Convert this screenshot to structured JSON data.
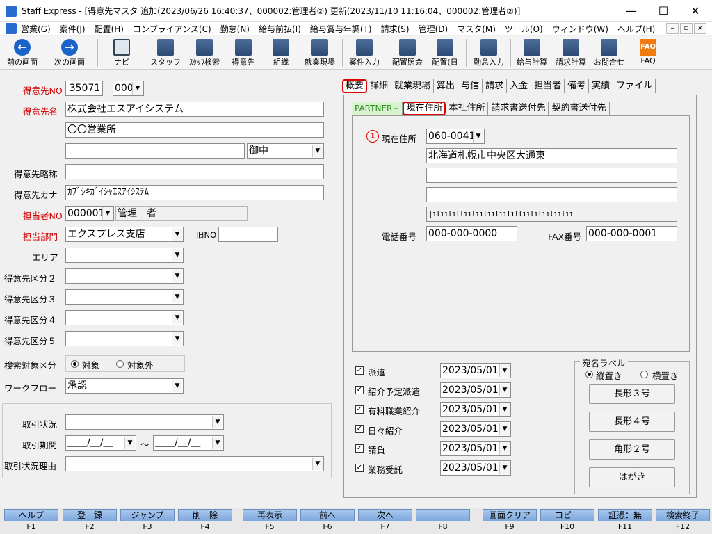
{
  "window": {
    "title": "Staff Express - [得意先マスタ  追加(2023/06/26 16:40:37、000002:管理者②)  更新(2023/11/10 11:16:04、000002:管理者②)]",
    "min": "—",
    "max": "☐",
    "close": "✕"
  },
  "menu": [
    "営業(G)",
    "案件(J)",
    "配置(H)",
    "コンプライアンス(C)",
    "勤怠(N)",
    "給与前払(I)",
    "給与賞与年調(T)",
    "請求(S)",
    "管理(D)",
    "マスタ(M)",
    "ツール(O)",
    "ウィンドウ(W)",
    "ヘルプ(H)"
  ],
  "mdi": [
    "–",
    "▫",
    "×"
  ],
  "toolbar": {
    "back": "前の画面",
    "forward": "次の画面",
    "navi": "ナビ",
    "staff": "スタッフ",
    "staff_search": "ｽﾀｯﾌ検索",
    "customer": "得意先",
    "org": "組織",
    "site": "就業現場",
    "case_entry": "案件入力",
    "placement_query": "配置照会",
    "placement_day": "配置(日",
    "attendance": "勤怠入力",
    "payroll": "給与計算",
    "billing": "請求計算",
    "contact": "お問合せ",
    "faq": "FAQ",
    "faq_icon": "FAQ"
  },
  "form": {
    "code_label": "得意先NO",
    "code": "35071",
    "code_sep": "-",
    "code_sub": "000",
    "name_label": "得意先名",
    "name1": "株式会社エスアイシステム",
    "name2": "〇〇営業所",
    "name3": "",
    "honorific": "御中",
    "short_label": "得意先略称",
    "short": "",
    "kana_label": "得意先カナ",
    "kana": "ｶﾌﾞｼｷｶﾞｲｼｬｴｽｱｲｼｽﾃﾑ",
    "staff_label": "担当者NO",
    "staff_no": "000001",
    "staff_name": "管理　者",
    "dept_label": "担当部門",
    "dept": "エクスプレス支店",
    "old_no_label": "旧NO",
    "old_no": "",
    "area_label": "エリア",
    "cat2_label": "得意先区分２",
    "cat3_label": "得意先区分３",
    "cat4_label": "得意先区分４",
    "cat5_label": "得意先区分５",
    "search_label": "検索対象区分",
    "search_on": "対象",
    "search_off": "対象外",
    "workflow_label": "ワークフロー",
    "workflow": "承認",
    "deal_status_label": "取引状況",
    "deal_period_label": "取引期間",
    "deal_from": "＿＿/＿/＿",
    "deal_tilde": "～",
    "deal_to": "＿＿/＿/＿",
    "deal_reason_label": "取引状況理由"
  },
  "tabs": [
    "概要",
    "詳細",
    "就業現場",
    "算出",
    "与信",
    "請求",
    "入金",
    "担当者",
    "備考",
    "実績",
    "ファイル"
  ],
  "subtabs": [
    "PARTNER+",
    "現在住所",
    "本社住所",
    "請求書送付先",
    "契約書送付先"
  ],
  "address": {
    "badge": "1",
    "label": "現在住所",
    "zip": "060-0041",
    "line1": "北海道札幌市中央区大通東",
    "line2": "",
    "line3": "",
    "barcode": "|ılıılıllıılıılıılıılıllıılılıılıılıı",
    "tel_label": "電話番号",
    "tel": "000-000-0000",
    "fax_label": "FAX番号",
    "fax": "000-000-0001"
  },
  "services": [
    {
      "label": "派遣",
      "date": "2023/05/01"
    },
    {
      "label": "紹介予定派遣",
      "date": "2023/05/01"
    },
    {
      "label": "有料職業紹介",
      "date": "2023/05/01"
    },
    {
      "label": "日々紹介",
      "date": "2023/05/01"
    },
    {
      "label": "請負",
      "date": "2023/05/01"
    },
    {
      "label": "業務受託",
      "date": "2023/05/01"
    }
  ],
  "label_box": {
    "title": "宛名ラベル",
    "vertical": "縦置き",
    "horizontal": "横置き",
    "buttons": [
      "長形３号",
      "長形４号",
      "角形２号",
      "はがき"
    ]
  },
  "fkeys": [
    {
      "label": "ヘルプ",
      "key": "F1"
    },
    {
      "label": "登　録",
      "key": "F2"
    },
    {
      "label": "ジャンプ",
      "key": "F3"
    },
    {
      "label": "削　除",
      "key": "F4"
    },
    {
      "label": "再表示",
      "key": "F5"
    },
    {
      "label": "前へ",
      "key": "F6"
    },
    {
      "label": "次へ",
      "key": "F7"
    },
    {
      "label": "",
      "key": "F8"
    },
    {
      "label": "画面クリア",
      "key": "F9"
    },
    {
      "label": "コピー",
      "key": "F10"
    },
    {
      "label": "証憑：無",
      "key": "F11"
    },
    {
      "label": "検索終了",
      "key": "F12"
    }
  ]
}
